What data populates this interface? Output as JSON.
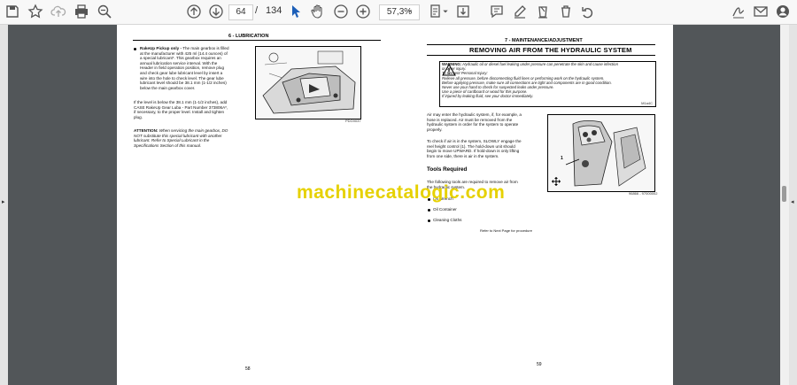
{
  "toolbar": {
    "page_current": "64",
    "page_sep": "/",
    "page_total": "134",
    "zoom": "57,3%",
    "icons": [
      "save-icon",
      "bookmark-star-icon",
      "upload-icon",
      "print-icon",
      "zoom-search-icon",
      "page-up-icon",
      "page-down-icon",
      "select-cursor-icon",
      "hand-pan-icon",
      "zoom-out-icon",
      "zoom-in-icon",
      "page-fit-icon",
      "download-icon",
      "comment-icon",
      "pen-icon",
      "erase-icon",
      "delete-icon",
      "undo-icon",
      "sign-icon",
      "mail-icon",
      "account-icon"
    ]
  },
  "left_page": {
    "header": "6 - LUBRICATION",
    "rakeup_lead": "RakeUp Pickup only -",
    "rakeup_body": [
      "The main gearbox is filled",
      "at the manufacturer with 425 ml (14.4 ounces) of",
      "a special lubricant*. This gearbox requires an",
      "annual lubrication service interval. With the",
      "Header in field operation position, remove plug",
      "and check gear lube lubricant level by insert a",
      "wire into the hole to check level. The gear lube",
      "lubricant level should be 38.1 mm (1-1/2 inches)",
      "below the main gearbox cover."
    ],
    "level_para": [
      "If the level is below the 38.1 mm (1-1/2 inches), add",
      "CASE RakeUp Gear Luba - Part Number 373806A*,",
      "if necessary, to the proper level. Install and tighten",
      "plug."
    ],
    "attention_lead": "ATTENTION:",
    "attention_body": [
      "When servicing the main gearbox, DO",
      "NOT substitute this special lubricant with another",
      "lubricant. Refer to Special Lubricant in the",
      "Specifications Section of this manual."
    ],
    "figure_caption": "PDG9037",
    "page_number": "58"
  },
  "right_page": {
    "header": "7 - MAINTENANCE/ADJUSTMENT",
    "title": "REMOVING AIR FROM THE HYDRAULIC SYSTEM",
    "warning_lead": "WARNING:",
    "warning_body": [
      "Hydraulic oil or diesel fuel leaking under pressure can penetrate the skin and cause infection",
      "or other injury.",
      "To Prevent Personal Injury:",
      "Relieve all pressure, before disconnecting fluid lines or performing work on the hydraulic system.",
      "Before applying pressure, make sure all connections are tight and components are in good condition.",
      "Never use your hand to check for suspected leaks under pressure.",
      "Use a piece of cardboard or wood for this purpose.",
      "If injured by leaking fluid, see your doctor immediately."
    ],
    "warning_code": "M1a4C",
    "air_para": [
      "Air may enter the hydraulic system, if, for example, a",
      "hose is replaced. Air must be removed from the",
      "hydraulic system in order for the system to operate",
      "properly."
    ],
    "check_para": [
      "To check if air is in the system, SLOWLY engage the",
      "reel height control (1). The hold-down unit should",
      "begin to move UPWARD. If hold-down is only lifting",
      "from one side, there is air in the system."
    ],
    "tools_heading": "Tools Required",
    "tools_intro": [
      "The following tools are required to remove air from",
      "the hydraulic system."
    ],
    "tools": [
      "Oil Wrench",
      "Oil Container",
      "Cleaning Cloths"
    ],
    "next_page": "Refer to Next Page for procedure",
    "figure_caption": "96866 - 97000002",
    "figure_callout": "1",
    "page_number": "59"
  },
  "watermark": "machinecatalogic.com"
}
